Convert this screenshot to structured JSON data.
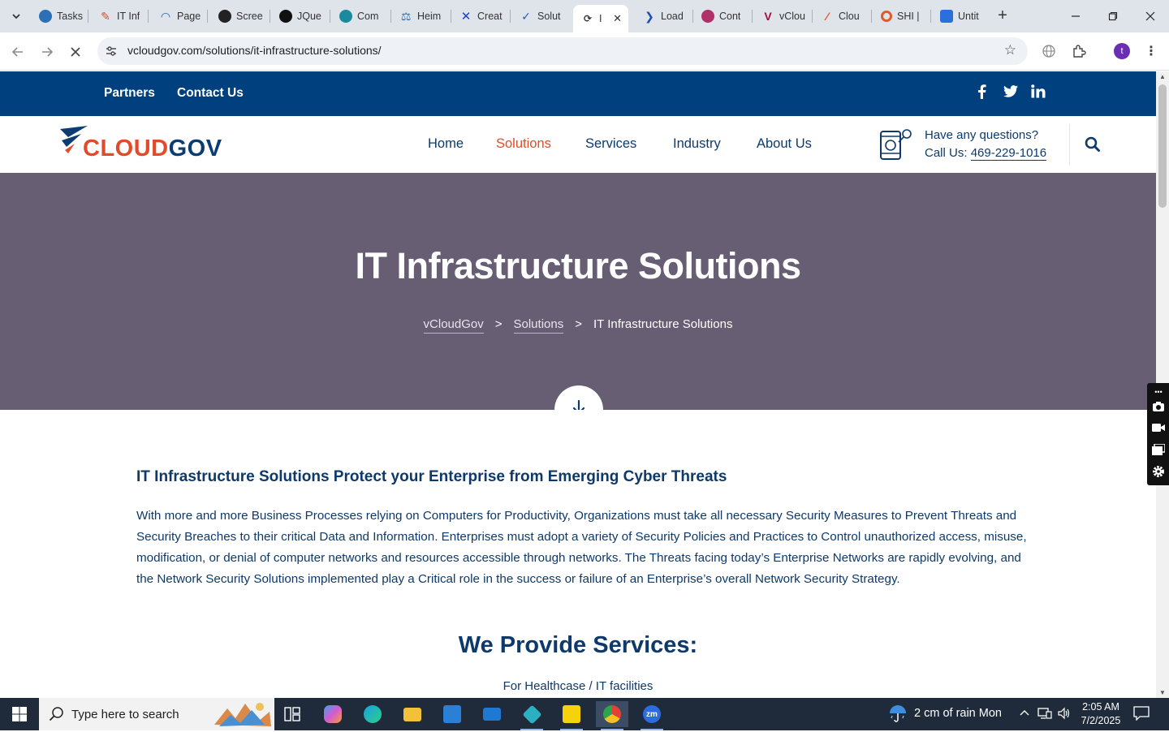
{
  "browser": {
    "tabs": [
      {
        "title": "Tasks",
        "color": "#2b6fb5"
      },
      {
        "title": "IT Inf",
        "color": "#e04c2a"
      },
      {
        "title": "Page",
        "color": "#1f5fb0"
      },
      {
        "title": "Scree",
        "color": "#222222"
      },
      {
        "title": "JQue",
        "color": "#111111"
      },
      {
        "title": "Com",
        "color": "#1b8a9e"
      },
      {
        "title": "Heim",
        "color": "#2a6fb0"
      },
      {
        "title": "Creat",
        "color": "#2040c0"
      },
      {
        "title": "Solut",
        "color": "#1f5fb0"
      },
      {
        "title": "I",
        "color": "#444444"
      },
      {
        "title": "Load",
        "color": "#1f4fb0"
      },
      {
        "title": "Cont",
        "color": "#b0306a"
      },
      {
        "title": "vClou",
        "color": "#a0103a"
      },
      {
        "title": "Clou",
        "color": "#e04c2a"
      },
      {
        "title": "SHI |",
        "color": "#e05a2a"
      },
      {
        "title": "Untit",
        "color": "#2b6fdc"
      }
    ],
    "url": "vcloudgov.com/solutions/it-infrastructure-solutions/",
    "profile_initial": "t"
  },
  "site": {
    "topbar": {
      "partners": "Partners",
      "contact": "Contact Us"
    },
    "social": {
      "facebook": "f",
      "twitter": "t",
      "linkedin": "in"
    },
    "logo": {
      "part1": "CLOUD",
      "part2": "GOV"
    },
    "menu": {
      "home": "Home",
      "solutions": "Solutions",
      "services": "Services",
      "industry": "Industry",
      "about": "About Us"
    },
    "questions": "Have any questions?",
    "call_label": "Call Us: ",
    "phone": "469-229-1016",
    "hero": {
      "title": "IT Infrastructure Solutions",
      "crumb1": "vCloudGov",
      "crumb2": "Solutions",
      "crumb3": "IT Infrastructure Solutions",
      "sep": ">"
    },
    "content": {
      "heading": "IT Infrastructure Solutions Protect your Enterprise from Emerging Cyber Threats",
      "paragraph": "With more and more Business Processes relying on Computers for Productivity, Organizations must take all necessary Security Measures to Prevent Threats and Security Breaches to their critical Data and Information. Enterprises must adopt a variety of Security Policies and Practices to Control unauthorized access, misuse, modification, or denial of computer networks and resources accessible through networks. The Threats facing today’s Enterprise Networks are rapidly evolving, and the Network Security Solutions implemented play a Critical role in the success or failure of an Enterprise’s overall Network Security Strategy.",
      "services_heading": "We Provide Services:",
      "services_sub": "For Healthcase / IT facilities"
    }
  },
  "taskbar": {
    "search_placeholder": "Type here to search",
    "weather": "2 cm of rain  Mon",
    "time": "2:05 AM",
    "date": "7/2/2025"
  }
}
